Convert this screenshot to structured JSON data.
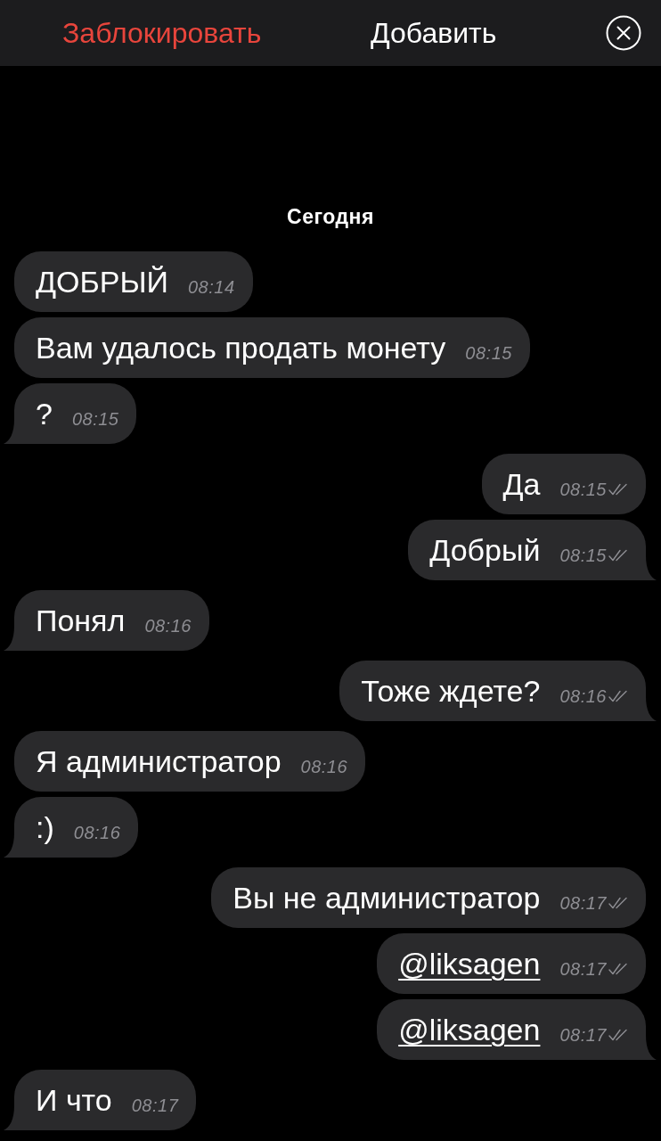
{
  "top_bar": {
    "block_label": "Заблокировать",
    "add_label": "Добавить"
  },
  "date_header": "Сегодня",
  "messages": [
    {
      "kind": "incoming",
      "text": "ДОБРЫЙ",
      "time": "08:14",
      "tail": false,
      "link": false
    },
    {
      "kind": "incoming",
      "text": "Вам удалось продать монету",
      "time": "08:15",
      "tail": false,
      "link": false
    },
    {
      "kind": "incoming",
      "text": "?",
      "time": "08:15",
      "tail": true,
      "link": false
    },
    {
      "kind": "outgoing",
      "text": "Да",
      "time": "08:15",
      "tail": false,
      "link": false,
      "read": true
    },
    {
      "kind": "outgoing",
      "text": "Добрый",
      "time": "08:15",
      "tail": true,
      "link": false,
      "read": true
    },
    {
      "kind": "incoming",
      "text": "Понял",
      "time": "08:16",
      "tail": true,
      "link": false
    },
    {
      "kind": "outgoing",
      "text": "Тоже ждете?",
      "time": "08:16",
      "tail": true,
      "link": false,
      "read": true
    },
    {
      "kind": "incoming",
      "text": "Я администратор",
      "time": "08:16",
      "tail": false,
      "link": false
    },
    {
      "kind": "incoming",
      "text": ":)",
      "time": "08:16",
      "tail": true,
      "link": false
    },
    {
      "kind": "outgoing",
      "text": "Вы не администратор",
      "time": "08:17",
      "tail": false,
      "link": false,
      "read": true
    },
    {
      "kind": "outgoing",
      "text": "@liksagen",
      "time": "08:17",
      "tail": false,
      "link": true,
      "read": true
    },
    {
      "kind": "outgoing",
      "text": "@liksagen",
      "time": "08:17",
      "tail": true,
      "link": true,
      "read": true
    },
    {
      "kind": "incoming",
      "text": "И что",
      "time": "08:17",
      "tail": true,
      "link": false
    }
  ]
}
